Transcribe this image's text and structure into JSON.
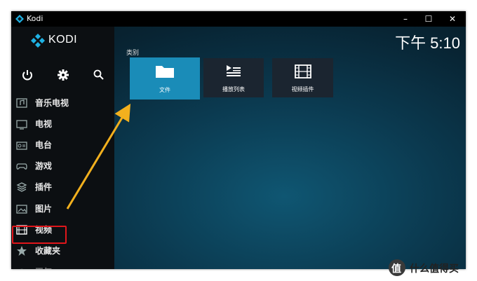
{
  "window": {
    "title": "Kodi",
    "controls": {
      "minimize": "–",
      "maximize": "☐",
      "close": "✕"
    }
  },
  "logo": {
    "text": "KODI"
  },
  "clock": {
    "time": "下午 5:10"
  },
  "top_icons": [
    "power-icon",
    "gear-icon",
    "search-icon"
  ],
  "sidebar": {
    "items": [
      {
        "label": "音乐电视",
        "icon": "music-video-icon"
      },
      {
        "label": "电视",
        "icon": "tv-icon"
      },
      {
        "label": "电台",
        "icon": "radio-icon"
      },
      {
        "label": "游戏",
        "icon": "gamepad-icon"
      },
      {
        "label": "插件",
        "icon": "addons-icon"
      },
      {
        "label": "图片",
        "icon": "pictures-icon"
      },
      {
        "label": "视频",
        "icon": "film-icon"
      },
      {
        "label": "收藏夹",
        "icon": "star-icon"
      },
      {
        "label": "天气",
        "icon": "weather-icon"
      }
    ],
    "selected": "视频"
  },
  "main": {
    "section_label": "类别",
    "tiles": [
      {
        "label": "文件",
        "icon": "folder-icon",
        "active": true
      },
      {
        "label": "播放列表",
        "icon": "playlist-icon",
        "active": false
      },
      {
        "label": "视频插件",
        "icon": "film-icon",
        "active": false
      }
    ]
  },
  "annotation": {
    "arrow_color": "#f2b01e",
    "box_color": "#e0161b"
  },
  "watermark": {
    "text": "什么值得买",
    "badge": "值"
  }
}
